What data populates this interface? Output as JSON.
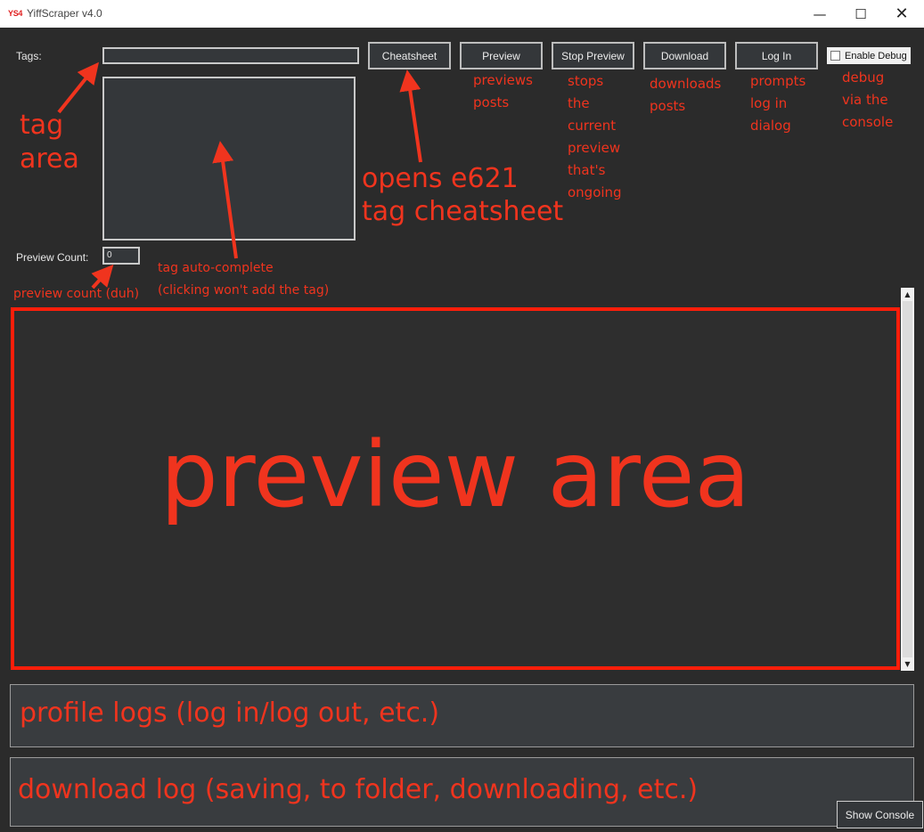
{
  "window": {
    "icon_text": "YS4",
    "title": "YiffScraper v4.0",
    "minimize_glyph": "—",
    "maximize_glyph": "☐",
    "close_glyph": "✕"
  },
  "form": {
    "tags_label": "Tags:",
    "tags_value": "",
    "preview_count_label": "Preview Count:",
    "preview_count_value": "0"
  },
  "toolbar": {
    "cheatsheet_label": "Cheatsheet",
    "preview_label": "Preview",
    "stop_preview_label": "Stop Preview",
    "download_label": "Download",
    "login_label": "Log In",
    "debug_label": "Enable Debug",
    "debug_checked": false
  },
  "annotations": {
    "tag_area": [
      "tag",
      "area"
    ],
    "cheatsheet": [
      "opens e621",
      "tag cheatsheet"
    ],
    "preview": [
      "previews",
      "posts"
    ],
    "stop_preview": [
      "stops",
      "the",
      "current",
      "preview",
      "that's",
      "ongoing"
    ],
    "download": [
      "downloads",
      "posts"
    ],
    "login": [
      "prompts",
      "log in",
      "dialog"
    ],
    "debug": [
      "debug",
      "via the",
      "console"
    ],
    "autocomplete": [
      "tag auto-complete",
      "(clicking won't add the tag)"
    ],
    "preview_count": "preview count (duh)",
    "preview_area": "preview area",
    "profile_logs": "profile logs (log in/log out, etc.)",
    "download_log": "download log (saving, to folder, downloading, etc.)"
  },
  "footer": {
    "show_console_label": "Show Console"
  },
  "icons": {
    "scroll_up": "▲",
    "scroll_down": "▼"
  },
  "colors": {
    "annotation": "#f0341e",
    "background": "#2b2b2b"
  }
}
